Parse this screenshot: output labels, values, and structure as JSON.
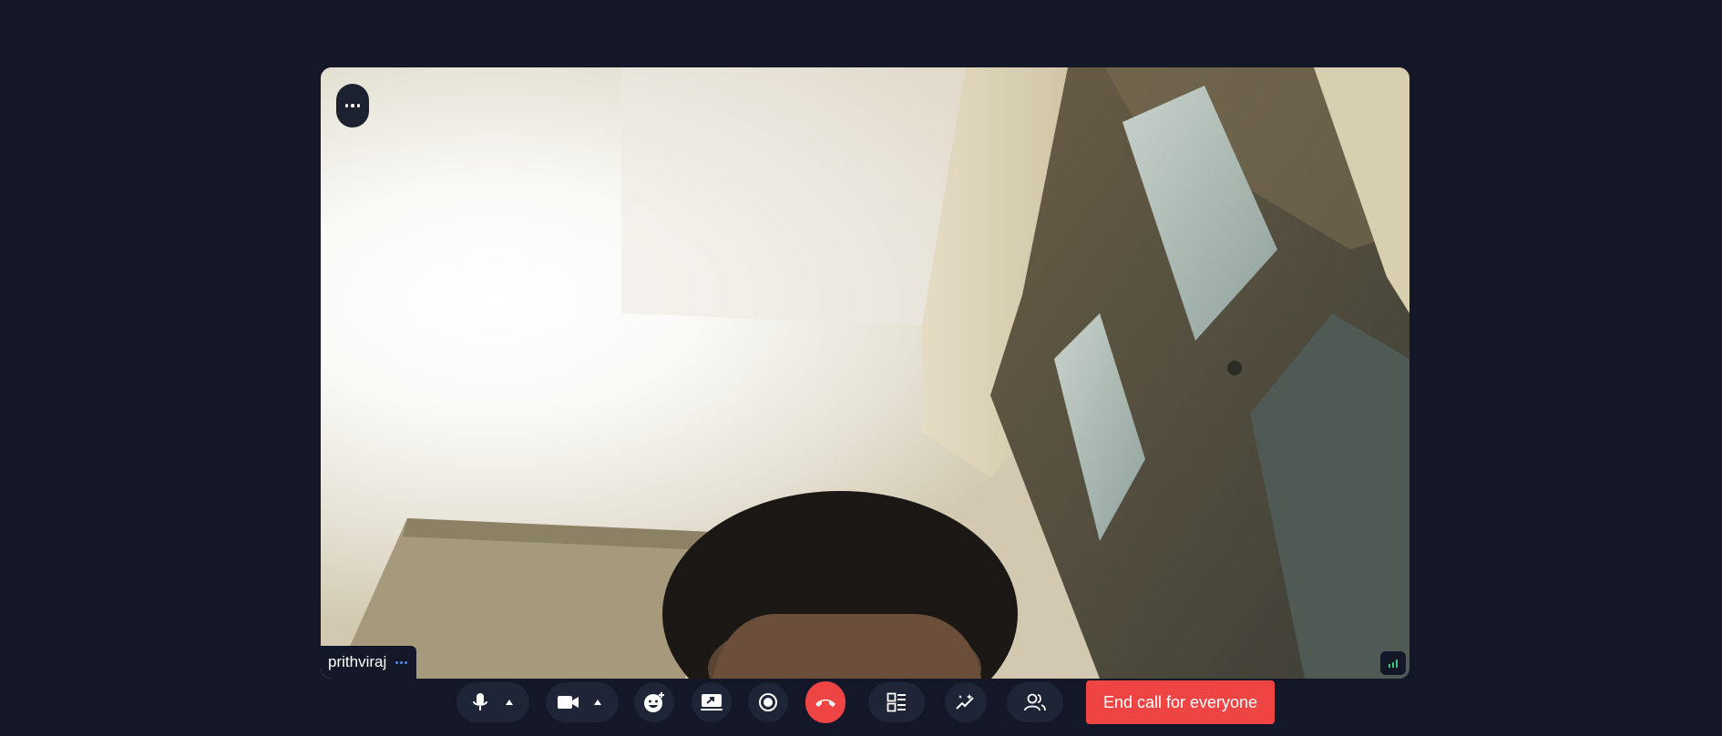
{
  "participant": {
    "name": "prithviraj"
  },
  "controls": {
    "mic": {
      "icon": "microphone-icon",
      "options_icon": "caret-up-icon"
    },
    "camera": {
      "icon": "video-camera-icon",
      "options_icon": "caret-up-icon"
    },
    "reactions": {
      "icon": "emoji-icon"
    },
    "share_screen": {
      "icon": "screen-share-icon"
    },
    "record": {
      "icon": "record-icon"
    },
    "leave": {
      "icon": "phone-hangup-icon"
    },
    "layout": {
      "icon": "layout-icon"
    },
    "effects": {
      "icon": "sparkles-icon"
    },
    "participants": {
      "icon": "users-icon"
    },
    "end_call_label": "End call for everyone"
  },
  "tile": {
    "menu_icon": "more-horizontal-icon",
    "name_menu_icon": "more-dots-icon",
    "signal_icon": "network-signal-icon"
  },
  "colors": {
    "background": "#141727",
    "control_bg": "#1d2536",
    "danger": "#ee4444",
    "signal": "#3fbf7f",
    "accent": "#4b8bf5"
  }
}
